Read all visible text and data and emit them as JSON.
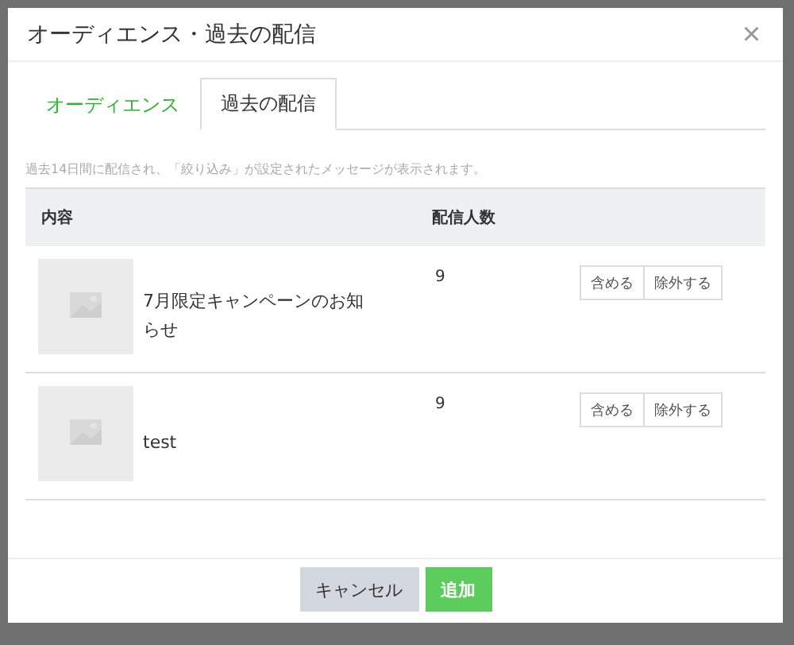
{
  "dialog": {
    "title": "オーディエンス・過去の配信",
    "close": "×"
  },
  "tabs": [
    {
      "label": "オーディエンス",
      "selected": false
    },
    {
      "label": "過去の配信",
      "selected": true
    }
  ],
  "note": "過去14日間に配信され、「絞り込み」が設定されたメッセージが表示されます。",
  "table": {
    "columns": [
      "内容",
      "配信人数"
    ],
    "rows": [
      {
        "content": "7月限定キャンペーンのお知らせ",
        "recipients": "9",
        "include": "含める",
        "exclude": "除外する"
      },
      {
        "content": "test",
        "recipients": "9",
        "include": "含める",
        "exclude": "除外する"
      }
    ]
  },
  "footer": {
    "cancel": "キャンセル",
    "add": "追加"
  }
}
